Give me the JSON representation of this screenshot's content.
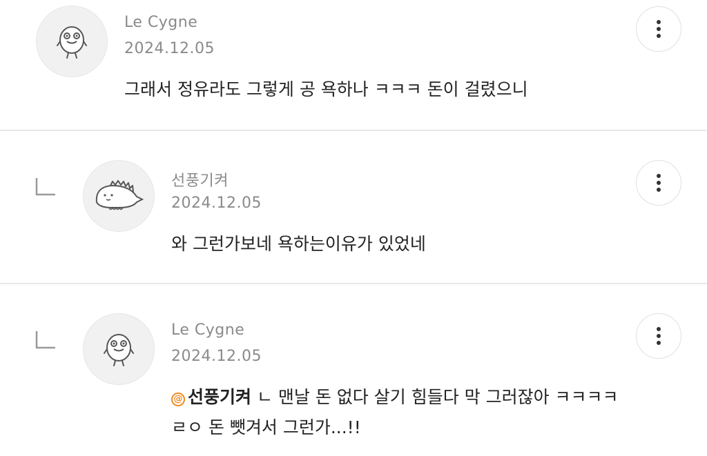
{
  "comments": [
    {
      "author": "Le Cygne",
      "date": "2024.12.05",
      "avatar": "egg-character-avatar",
      "text": "그래서 정유라도 그렇게 공 욕하나 ㅋㅋㅋ 돈이 걸렸으니",
      "is_reply": false
    },
    {
      "author": "선풍기켜",
      "date": "2024.12.05",
      "avatar": "dinosaur-character-avatar",
      "text": "와 그런가보네 욕하는이유가 있었네",
      "is_reply": true
    },
    {
      "author": "Le Cygne",
      "date": "2024.12.05",
      "avatar": "egg-character-avatar",
      "mention": "선풍기켜",
      "mention_icon": "@",
      "text_line1": " ㄴ 맨날 돈 없다 살기 힘들다 막 그러잖아 ㅋㅋㅋㅋ",
      "text_line2": "ㄹㅇ 돈 뺏겨서 그런가...!!",
      "is_reply": true
    }
  ],
  "icons": {
    "more": "more-vertical-icon",
    "reply": "reply-arrow-icon"
  },
  "colors": {
    "meta_text": "#8a8a8a",
    "body_text": "#222222",
    "divider": "#e8e8e8",
    "mention_accent": "#f08a24"
  }
}
